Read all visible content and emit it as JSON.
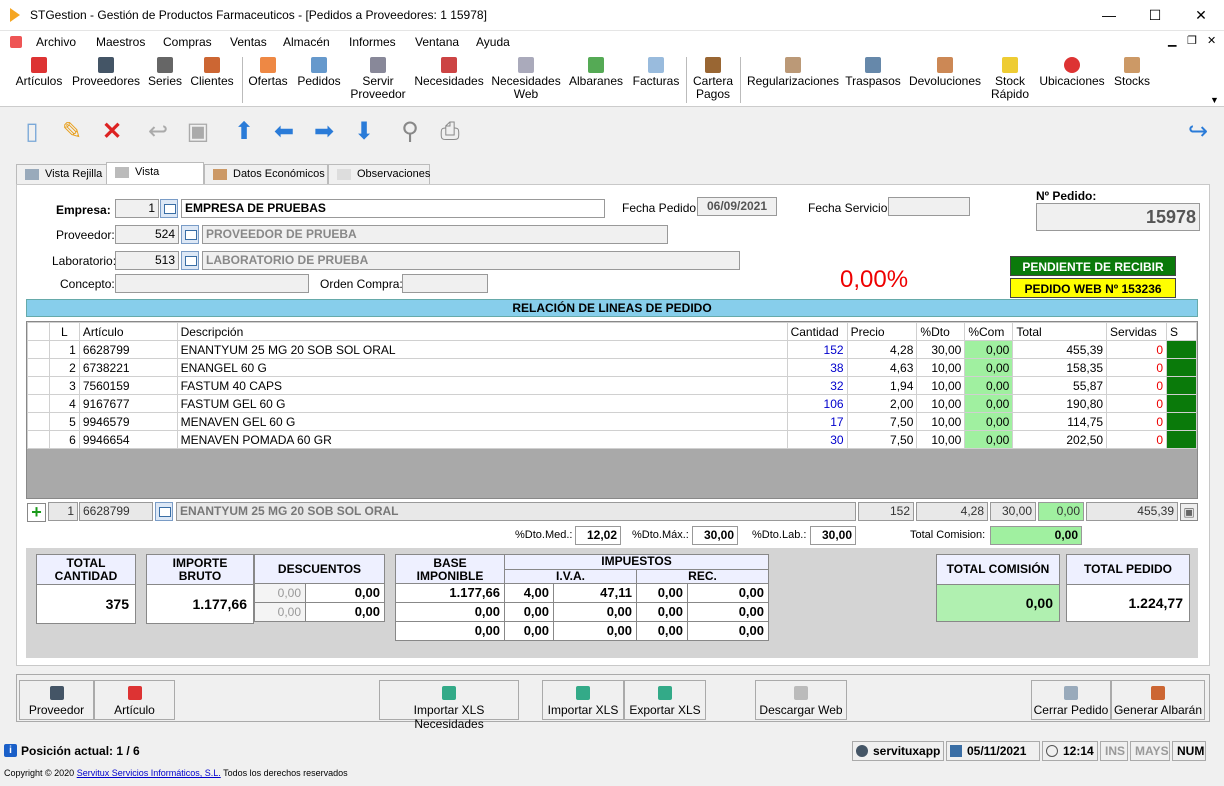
{
  "window": {
    "title": "STGestion - Gestión de Productos Farmaceuticos - [Pedidos a Proveedores: 1 15978]",
    "minimize": "—",
    "maximize": "☐",
    "close": "✕"
  },
  "menu": [
    "Archivo",
    "Maestros",
    "Compras",
    "Ventas",
    "Almacén",
    "Informes",
    "Ventana",
    "Ayuda"
  ],
  "ribbon": [
    {
      "l1": "Artículos",
      "l2": ""
    },
    {
      "l1": "Proveedores",
      "l2": ""
    },
    {
      "l1": "Series",
      "l2": ""
    },
    {
      "l1": "Clientes",
      "l2": ""
    },
    {
      "l1": "Ofertas",
      "l2": ""
    },
    {
      "l1": "Pedidos",
      "l2": ""
    },
    {
      "l1": "Servir",
      "l2": "Proveedor"
    },
    {
      "l1": "Necesidades",
      "l2": ""
    },
    {
      "l1": "Necesidades",
      "l2": "Web"
    },
    {
      "l1": "Albaranes",
      "l2": ""
    },
    {
      "l1": "Facturas",
      "l2": ""
    },
    {
      "l1": "Cartera",
      "l2": "Pagos"
    },
    {
      "l1": "Regularizaciones",
      "l2": ""
    },
    {
      "l1": "Traspasos",
      "l2": ""
    },
    {
      "l1": "Devoluciones",
      "l2": ""
    },
    {
      "l1": "Stock",
      "l2": "Rápido"
    },
    {
      "l1": "Ubicaciones",
      "l2": ""
    },
    {
      "l1": "Stocks",
      "l2": ""
    }
  ],
  "tabs": [
    "Vista Rejilla",
    "Vista Registro",
    "Datos Económicos",
    "Observaciones"
  ],
  "form": {
    "empresa_label": "Empresa:",
    "empresa_code": "1",
    "empresa_name": "EMPRESA DE PRUEBAS",
    "fecha_pedido_label": "Fecha Pedido:",
    "fecha_pedido": "06/09/2021",
    "fecha_servicio_label": "Fecha Servicio:",
    "fecha_servicio": "",
    "npedido_label": "Nº Pedido:",
    "npedido": "15978",
    "proveedor_label": "Proveedor:",
    "proveedor_code": "524",
    "proveedor_name": "PROVEEDOR DE PRUEBA",
    "laboratorio_label": "Laboratorio:",
    "laboratorio_code": "513",
    "laboratorio_name": "LABORATORIO DE PRUEBA",
    "concepto_label": "Concepto:",
    "concepto": "",
    "orden_label": "Orden Compra:",
    "orden": "",
    "pct": "0,00%",
    "status": "PENDIENTE DE RECIBIR",
    "web": "PEDIDO WEB Nº 153236"
  },
  "lines": {
    "header": "RELACIÓN DE LINEAS DE PEDIDO",
    "columns": [
      "L",
      "Artículo",
      "Descripción",
      "Cantidad",
      "Precio",
      "%Dto",
      "%Com",
      "Total",
      "Servidas",
      "S"
    ],
    "rows": [
      [
        "1",
        "6628799",
        "ENANTYUM 25 MG 20 SOB SOL ORAL",
        "152",
        "4,28",
        "30,00",
        "0,00",
        "455,39",
        "0"
      ],
      [
        "2",
        "6738221",
        "ENANGEL 60 G",
        "38",
        "4,63",
        "10,00",
        "0,00",
        "158,35",
        "0"
      ],
      [
        "3",
        "7560159",
        "FASTUM 40 CAPS",
        "32",
        "1,94",
        "10,00",
        "0,00",
        "55,87",
        "0"
      ],
      [
        "4",
        "9167677",
        "FASTUM GEL 60 G",
        "106",
        "2,00",
        "10,00",
        "0,00",
        "190,80",
        "0"
      ],
      [
        "5",
        "9946579",
        "MENAVEN GEL 60 G",
        "17",
        "7,50",
        "10,00",
        "0,00",
        "114,75",
        "0"
      ],
      [
        "6",
        "9946654",
        "MENAVEN POMADA 60 GR",
        "30",
        "7,50",
        "10,00",
        "0,00",
        "202,50",
        "0"
      ]
    ]
  },
  "edit": {
    "l": "1",
    "articulo": "6628799",
    "desc": "ENANTYUM 25 MG 20 SOB SOL ORAL",
    "cantidad": "152",
    "precio": "4,28",
    "dto": "30,00",
    "com": "0,00",
    "total": "455,39"
  },
  "dtos": {
    "med_label": "%Dto.Med.:",
    "med": "12,02",
    "max_label": "%Dto.Máx.:",
    "max": "30,00",
    "lab_label": "%Dto.Lab.:",
    "lab": "30,00",
    "com_label": "Total Comision:",
    "com": "0,00"
  },
  "totals": {
    "cantidad_label1": "TOTAL",
    "cantidad_label2": "CANTIDAD",
    "cantidad": "375",
    "bruto_label1": "IMPORTE",
    "bruto_label2": "BRUTO",
    "bruto": "1.177,66",
    "desc_label": "DESCUENTOS",
    "desc_pct1": "0,00",
    "desc_val1": "0,00",
    "desc_pct2": "0,00",
    "desc_val2": "0,00",
    "base_label1": "BASE",
    "base_label2": "IMPONIBLE",
    "impuestos_label": "IMPUESTOS",
    "iva_label": "I.V.A.",
    "rec_label": "REC.",
    "rows": [
      [
        "1.177,66",
        "4,00",
        "47,11",
        "0,00",
        "0,00"
      ],
      [
        "0,00",
        "0,00",
        "0,00",
        "0,00",
        "0,00"
      ],
      [
        "0,00",
        "0,00",
        "0,00",
        "0,00",
        "0,00"
      ]
    ],
    "comision_label": "TOTAL COMISIÓN",
    "comision": "0,00",
    "pedido_label": "TOTAL PEDIDO",
    "pedido": "1.224,77"
  },
  "buttons": [
    "Proveedor",
    "Artículo",
    "Importar XLS Necesidades",
    "Importar XLS",
    "Exportar XLS",
    "Descargar Web",
    "Cerrar Pedido",
    "Generar Albarán"
  ],
  "status": {
    "position": "Posición actual: 1 / 6",
    "user": "servituxapp",
    "date": "05/11/2021",
    "time": "12:14",
    "ins": "INS",
    "mays": "MAYS",
    "num": "NUM"
  },
  "copyright": {
    "pre": "Copyright © 2020",
    "link": "Servitux Servicios Informáticos, S.L.",
    "post": "Todos los derechos reservados"
  }
}
